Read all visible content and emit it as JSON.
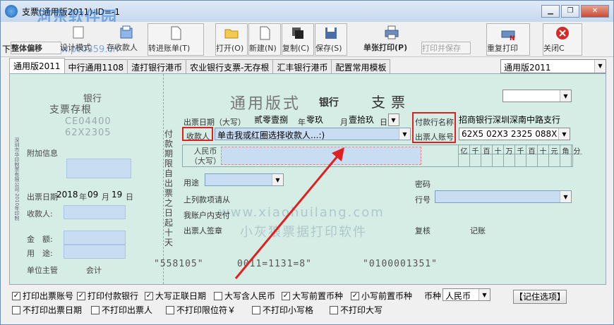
{
  "window": {
    "title": "支票(通用版2011)-ID=-1",
    "watermark_logo": "河东软件园",
    "watermark_url": "www.pc0359.cn",
    "controls": {
      "minimize": "▁",
      "restore": "❐",
      "close": "✕"
    }
  },
  "toolbar": {
    "whole_move": "整体偏移",
    "design_mode": "设计模式",
    "save_payee": "存收款人",
    "transfer_ledger": "转进账单(T)",
    "open": "打开(O)",
    "new": "新建(N)",
    "copy": "复制(C)",
    "save": "保存(S)",
    "single_print": "单张打印(P)",
    "print_save": "打印并保存",
    "repeat_print": "重复打印",
    "close": "关闭C",
    "partial_prefix": "下"
  },
  "tabs": [
    "通用版2011",
    "中行通用1108",
    "渣打银行港币",
    "农业银行支票-无存根",
    "汇丰银行港币",
    "配置常用模板"
  ],
  "template_select": "通用版2011",
  "stub": {
    "bank": "银行",
    "title": "支票存根",
    "number_masked": "CE04400\n62X2305",
    "side_text": "深圳市华印制票有限公司·2010年印制",
    "attach_label": "附加信息",
    "date_label": "出票日期",
    "year": "2018",
    "year_unit": "年",
    "month": "09",
    "month_unit": "月",
    "day": "19",
    "day_unit": "日",
    "payee_label": "收款人:",
    "amount_label": "金　额:",
    "usage_label": "用　途:",
    "unit_head": "单位主管",
    "accountant": "会计"
  },
  "cheque": {
    "title": "通用版式",
    "bank": "银行",
    "cheque_word": "支票",
    "date_label": "出票日期（大写）",
    "year_value": "贰零壹捌",
    "year_unit": "年",
    "month_value": "零玖",
    "month_unit": "月",
    "day_value": "壹拾玖",
    "day_unit": "日",
    "payer_bank_label": "付款行名称",
    "payer_bank_value": "招商银行深圳深南中路支行",
    "payee_label": "收款人",
    "payee_placeholder": "单击我或红圈选择收款人...:)",
    "account_label": "出票人账号",
    "account_value": "62X5 02X3 2325 088X",
    "rmb_label": "人民币",
    "upper_label": "（大写）",
    "digit_headers": [
      "亿",
      "千",
      "百",
      "十",
      "万",
      "千",
      "百",
      "十",
      "元",
      "角",
      "分"
    ],
    "vertical_text": "付款期限自出票之日起十天",
    "usage_label": "用途",
    "password_label": "密码",
    "above_text": "上列款项请从",
    "account_pay_text": "我账户内支付",
    "drawer_sign": "出票人签章",
    "line_label": "行号",
    "check_label": "复核",
    "record_label": "记账",
    "watermark_url": "www.xiaohuilang.com",
    "watermark_name": "小灰狼票据打印软件",
    "micr_1": "\"558105\"",
    "micr_2": "0011=1131=8\"",
    "micr_3": "\"0100001351\""
  },
  "options": {
    "row1": [
      {
        "label": "打印出票账号",
        "checked": true
      },
      {
        "label": "打印付款银行",
        "checked": true
      },
      {
        "label": "大写正联日期",
        "checked": true
      },
      {
        "label": "大写含人民币",
        "checked": false
      },
      {
        "label": "大写前置币种",
        "checked": true
      },
      {
        "label": "小写前置币种",
        "checked": true
      }
    ],
    "currency_label": "币种",
    "currency_value": "人民币",
    "remember_button": "【记住选项】",
    "row2": [
      {
        "label": "不打印出票日期",
        "checked": false
      },
      {
        "label": "不打印出票人",
        "checked": false
      },
      {
        "label": "不打印限位符￥",
        "checked": false
      },
      {
        "label": "不打印小写格",
        "checked": false
      },
      {
        "label": "不打印大写",
        "checked": false
      }
    ]
  }
}
